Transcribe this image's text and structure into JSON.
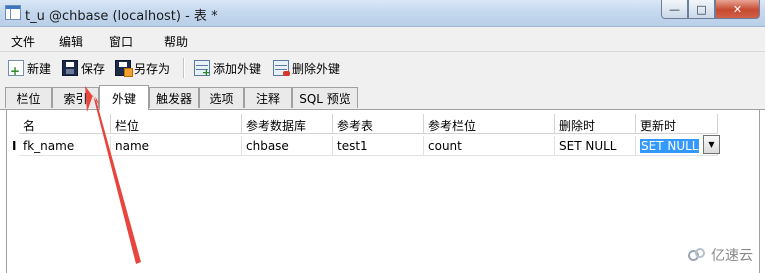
{
  "window": {
    "title": "t_u @chbase (localhost) - 表 *",
    "buttons": {
      "minimize": "—",
      "maximize": "□",
      "close": "✕"
    }
  },
  "menu": [
    "文件",
    "编辑",
    "窗口",
    "帮助"
  ],
  "toolbar": {
    "new": "新建",
    "save": "保存",
    "save_as": "另存为",
    "add_fk": "添加外键",
    "delete_fk": "删除外键"
  },
  "tabs": [
    "栏位",
    "索引",
    "外键",
    "触发器",
    "选项",
    "注释",
    "SQL 预览"
  ],
  "active_tab": "外键",
  "grid": {
    "columns": [
      "名",
      "栏位",
      "参考数据库",
      "参考表",
      "参考栏位",
      "删除时",
      "更新时"
    ],
    "rows": [
      {
        "name": "fk_name",
        "field": "name",
        "ref_db": "chbase",
        "ref_table": "test1",
        "ref_field": "count",
        "on_delete": "SET NULL",
        "on_update": "SET NULL"
      }
    ],
    "row_indicator": "I"
  },
  "icons": {
    "app": "table-icon",
    "new": "new-icon",
    "save": "save-icon",
    "save_as": "save-as-icon",
    "add_fk": "add-foreign-key-icon",
    "delete_fk": "delete-foreign-key-icon",
    "dropdown": "chevron-down-icon"
  },
  "annotation": {
    "arrow_color": "#e8453c"
  },
  "watermark": "亿速云"
}
